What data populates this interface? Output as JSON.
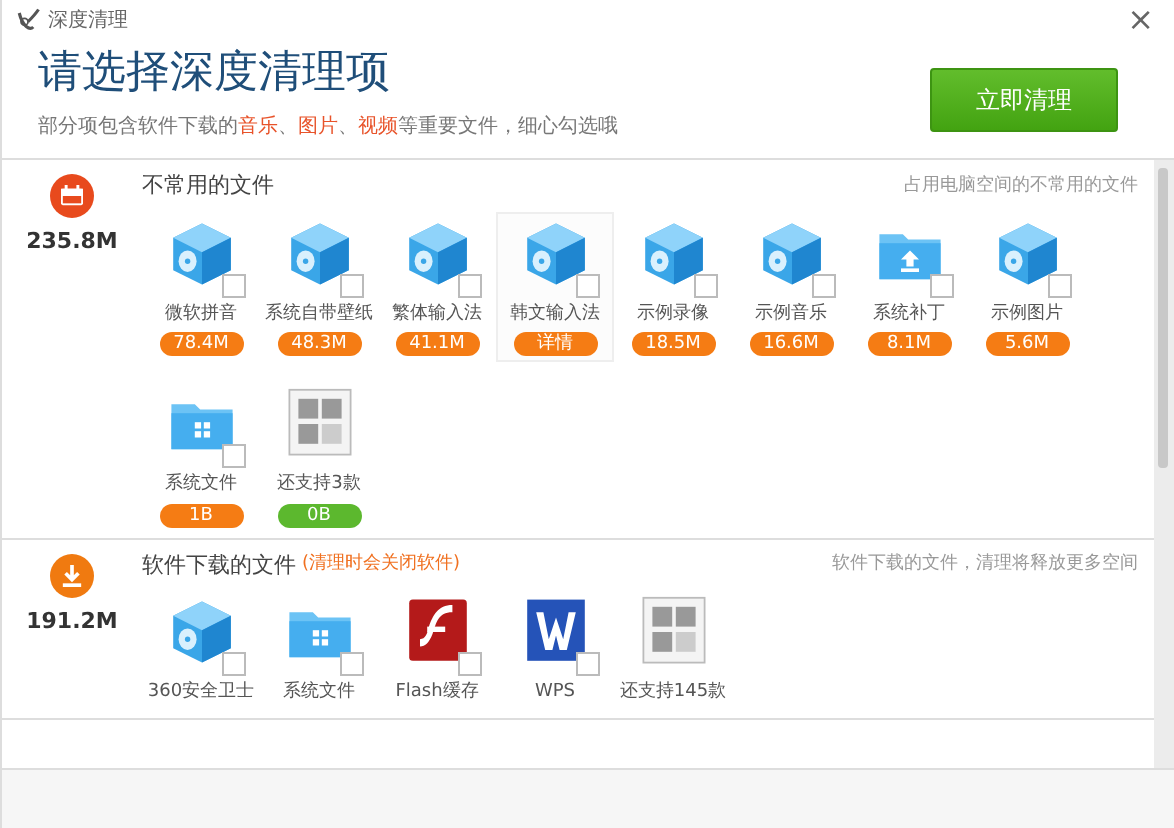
{
  "window": {
    "title": "深度清理",
    "close": "×"
  },
  "header": {
    "title": "请选择深度清理项",
    "subtitle": "部分项包含软件下载的**音乐**、**图片**、**视频**等重要文件，细心勾选哦",
    "button": "立即清理"
  },
  "sections": [
    {
      "kind": "calendar",
      "total": "235.8M",
      "title": "不常用的文件",
      "note": "占用电脑空间的不常用的文件",
      "items": [
        {
          "kind": "cube",
          "label": "微软拼音",
          "size": "78.4M",
          "color": "#f57c14",
          "checked": false,
          "selected": false
        },
        {
          "kind": "cube",
          "label": "系统自带壁纸",
          "size": "48.3M",
          "color": "#f57c14",
          "checked": false,
          "selected": false
        },
        {
          "kind": "cube",
          "label": "繁体输入法",
          "size": "41.1M",
          "color": "#f57c14",
          "checked": false,
          "selected": false
        },
        {
          "kind": "cube",
          "label": "韩文输入法",
          "size": "详情",
          "color": "#f57c14",
          "checked": false,
          "selected": true
        },
        {
          "kind": "cube",
          "label": "示例录像",
          "size": "18.5M",
          "color": "#f57c14",
          "checked": false,
          "selected": false
        },
        {
          "kind": "cube",
          "label": "示例音乐",
          "size": "16.6M",
          "color": "#f57c14",
          "checked": false,
          "selected": false
        },
        {
          "kind": "upload-folder",
          "label": "系统补丁",
          "size": "8.1M",
          "color": "#f57c14",
          "checked": false,
          "selected": false
        },
        {
          "kind": "cube",
          "label": "示例图片",
          "size": "5.6M",
          "color": "#f57c14",
          "checked": false,
          "selected": false
        },
        {
          "kind": "win-folder",
          "label": "系统文件",
          "size": "1B",
          "color": "#f57c14",
          "checked": false,
          "selected": false
        },
        {
          "kind": "more",
          "label": "还支持3款",
          "size": "0B",
          "color": "#5cb82e",
          "selected": false
        }
      ]
    },
    {
      "kind": "download",
      "total": "191.2M",
      "title": "软件下载的文件",
      "warning": "(清理时会关闭软件)",
      "note": "软件下载的文件，清理将释放更多空间",
      "items": [
        {
          "kind": "cube",
          "label": "360安全卫士",
          "checked": false,
          "selected": false
        },
        {
          "kind": "win-folder",
          "label": "系统文件",
          "checked": false,
          "selected": false
        },
        {
          "kind": "flash",
          "label": "Flash缓存",
          "checked": false,
          "selected": false
        },
        {
          "kind": "wps",
          "label": "WPS",
          "checked": false,
          "selected": false
        },
        {
          "kind": "more",
          "label": "还支持145款",
          "selected": false
        }
      ]
    }
  ]
}
